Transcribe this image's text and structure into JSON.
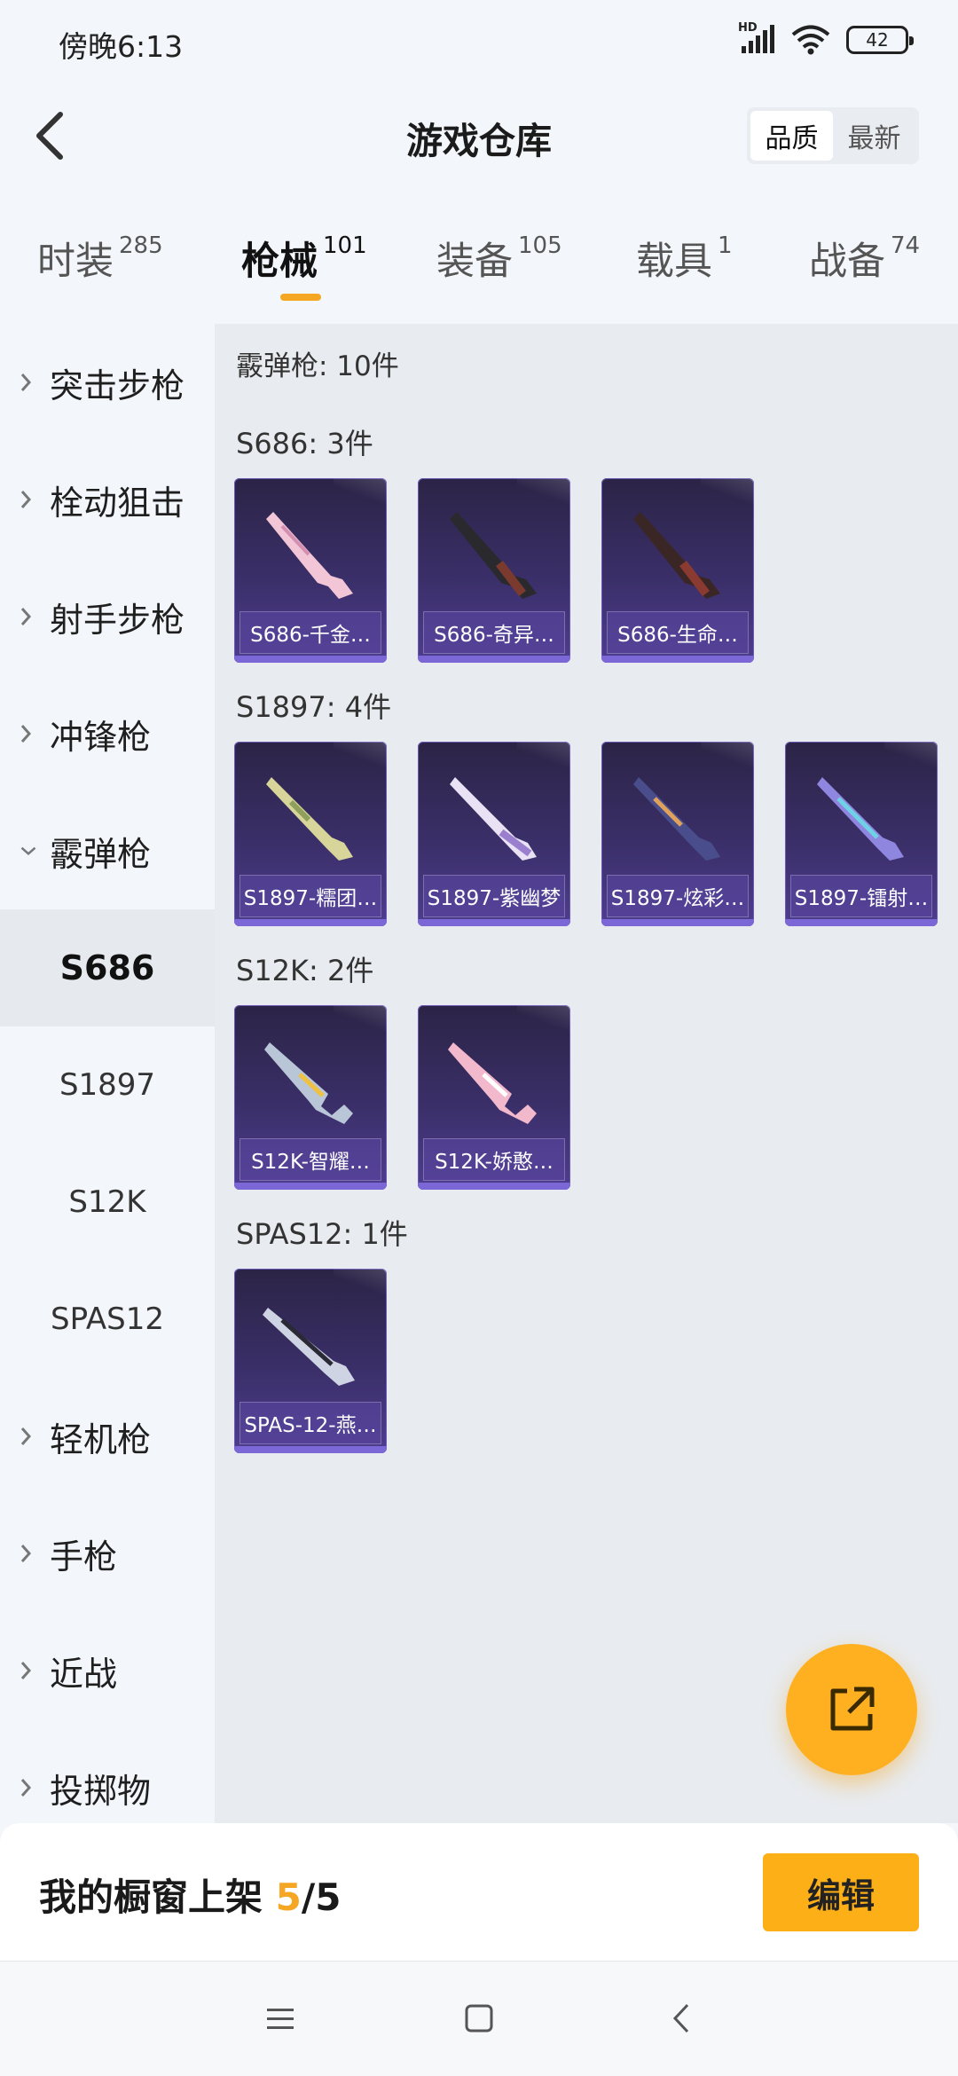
{
  "status": {
    "time": "傍晚6:13",
    "network": "HD",
    "battery": "42"
  },
  "header": {
    "title": "游戏仓库",
    "sort": {
      "options": [
        "品质",
        "最新"
      ],
      "selected": "品质"
    }
  },
  "tabs": [
    {
      "label": "时装",
      "count": "285"
    },
    {
      "label": "枪械",
      "count": "101"
    },
    {
      "label": "装备",
      "count": "105"
    },
    {
      "label": "载具",
      "count": "1"
    },
    {
      "label": "战备",
      "count": "74"
    }
  ],
  "active_tab": "枪械",
  "sidebar": {
    "categories": [
      "突击步枪",
      "栓动狙击",
      "射手步枪",
      "冲锋枪",
      "霰弹枪",
      "轻机枪",
      "手枪",
      "近战",
      "投掷物"
    ],
    "expanded": "霰弹枪",
    "subitems": [
      "S686",
      "S1897",
      "S12K",
      "SPAS12"
    ],
    "selected_sub": "S686"
  },
  "content": {
    "summary": "霰弹枪: 10件",
    "groups": [
      {
        "title": "S686: 3件",
        "items": [
          "S686-千金…",
          "S686-奇异…",
          "S686-生命…"
        ]
      },
      {
        "title": "S1897: 4件",
        "items": [
          "S1897-糯团…",
          "S1897-紫幽梦",
          "S1897-炫彩…",
          "S1897-镭射…"
        ]
      },
      {
        "title": "S12K: 2件",
        "items": [
          "S12K-智耀…",
          "S12K-娇憨…"
        ]
      },
      {
        "title": "SPAS12: 1件",
        "items": [
          "SPAS-12-燕…"
        ]
      }
    ]
  },
  "bottom": {
    "label": "我的橱窗上架",
    "current": "5",
    "separator": "/",
    "total": "5",
    "edit": "编辑"
  },
  "colors": {
    "accent": "#f5a623",
    "card_top": "#2b2446",
    "card_bottom": "#4e3d8f"
  },
  "icons": [
    "back-arrow-icon",
    "share-icon",
    "chevron-right-icon",
    "chevron-down-icon",
    "menu-icon",
    "home-icon",
    "back-icon"
  ]
}
